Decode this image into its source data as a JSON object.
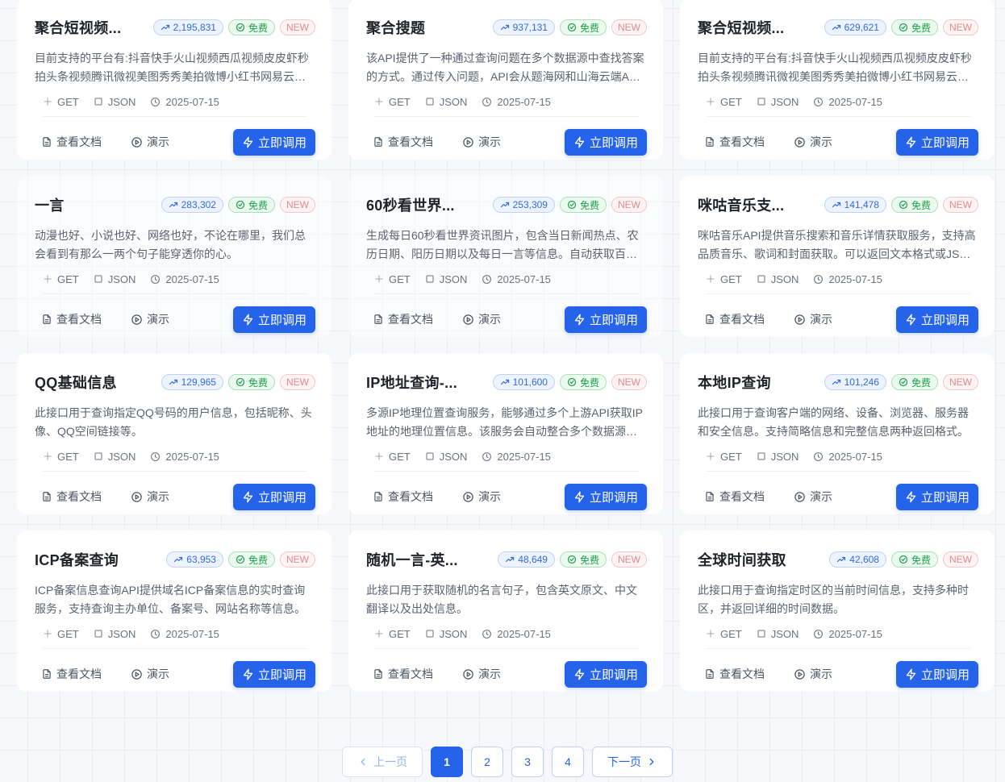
{
  "labels": {
    "docs": "查看文档",
    "demo": "演示",
    "call": "立即调用",
    "free": "免费",
    "new": "NEW",
    "method": "GET",
    "format": "JSON"
  },
  "colors": {
    "primary": "#2563eb",
    "free": "#1f9d4c",
    "new": "#e08d8d"
  },
  "cards": [
    {
      "title": "聚合短视频...",
      "count": "2,195,831",
      "desc": "目前支持的平台有:抖音快手火山视频西瓜视频皮皮虾秒拍头条视频腾讯微视美图秀秀美拍微博小红书网易云音乐等平台视频解析",
      "date": "2025-07-15"
    },
    {
      "title": "聚合搜题",
      "count": "937,131",
      "desc": "该API提供了一种通过查询问题在多个数据源中查找答案的方式。通过传入问题，API会从题海网和山海云端API等多个数据源中查询答案",
      "date": "2025-07-15"
    },
    {
      "title": "聚合短视频...",
      "count": "629,621",
      "desc": "目前支持的平台有:抖音快手火山视频西瓜视频皮皮虾秒拍头条视频腾讯微视美图秀秀美拍微博小红书网易云音乐等平台视频解析",
      "date": "2025-07-15"
    },
    {
      "title": "一言",
      "count": "283,302",
      "desc": "动漫也好、小说也好、网络也好，不论在哪里，我们总会看到有那么一两个句子能穿透你的心。",
      "date": "2025-07-15"
    },
    {
      "title": "60秒看世界...",
      "count": "253,309",
      "desc": "生成每日60秒看世界资讯图片，包含当日新闻热点、农历日期、阳历日期以及每日一言等信息。自动获取百度热搜等多个数据源",
      "date": "2025-07-15"
    },
    {
      "title": "咪咕音乐支...",
      "count": "141,478",
      "desc": "咪咕音乐API提供音乐搜索和音乐详情获取服务，支持高品质音乐、歌词和封面获取。可以返回文本格式或JSON格式的数据",
      "date": "2025-07-15"
    },
    {
      "title": "QQ基础信息",
      "count": "129,965",
      "desc": "此接口用于查询指定QQ号码的用户信息，包括昵称、头像、QQ空间链接等。",
      "date": "2025-07-15"
    },
    {
      "title": "IP地址查询-...",
      "count": "101,600",
      "desc": "多源IP地理位置查询服务，能够通过多个上游API获取IP地址的地理位置信息。该服务会自动整合多个数据源的查询结果",
      "date": "2025-07-15"
    },
    {
      "title": "本地IP查询",
      "count": "101,246",
      "desc": "此接口用于查询客户端的网络、设备、浏览器、服务器和安全信息。支持简略信息和完整信息两种返回格式。",
      "date": "2025-07-15"
    },
    {
      "title": "ICP备案查询",
      "count": "63,953",
      "desc": "ICP备案信息查询API提供域名ICP备案信息的实时查询服务，支持查询主办单位、备案号、网站名称等信息。",
      "date": "2025-07-15"
    },
    {
      "title": "随机一言-英...",
      "count": "48,649",
      "desc": "此接口用于获取随机的名言句子，包含英文原文、中文翻译以及出处信息。",
      "date": "2025-07-15"
    },
    {
      "title": "全球时间获取",
      "count": "42,608",
      "desc": "此接口用于查询指定时区的当前时间信息，支持多种时区，并返回详细的时间数据。",
      "date": "2025-07-15"
    }
  ],
  "pagination": {
    "prev": "上一页",
    "next": "下一页",
    "pages": [
      "1",
      "2",
      "3",
      "4"
    ],
    "current": "1"
  }
}
